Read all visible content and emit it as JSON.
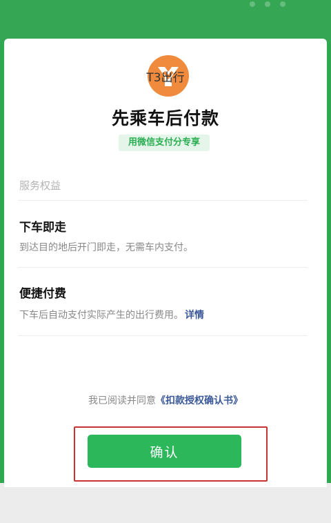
{
  "header": {
    "logo": {
      "icon": "t3-logo-icon",
      "color": "#f08a3c"
    },
    "app_name": "T3出行"
  },
  "main": {
    "title": "先乘车后付款",
    "badge": "用微信支付分专享",
    "section_label": "服务权益",
    "benefits": [
      {
        "title": "下车即走",
        "desc": "到达目的地后开门即走，无需车内支付。",
        "link": ""
      },
      {
        "title": "便捷付费",
        "desc": "下车后自动支付实际产生的出行费用。",
        "link": "详情"
      }
    ]
  },
  "footer": {
    "agree_prefix": "我已阅读并同意",
    "agreement_link": "《扣款授权确认书》",
    "confirm_label": "确认"
  },
  "colors": {
    "brand_green": "#2bb75a",
    "highlight_red": "#c83232",
    "link_blue": "#3b5998"
  }
}
